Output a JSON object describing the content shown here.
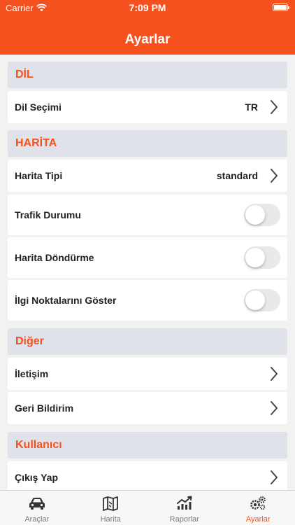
{
  "status": {
    "carrier": "Carrier",
    "time": "7:09 PM"
  },
  "header": {
    "title": "Ayarlar"
  },
  "sections": {
    "dil": {
      "title": "DİL",
      "dil_secimi": {
        "label": "Dil Seçimi",
        "value": "TR"
      }
    },
    "harita": {
      "title": "HARİTA",
      "harita_tipi": {
        "label": "Harita Tipi",
        "value": "standard"
      },
      "trafik": {
        "label": "Trafik Durumu",
        "on": false
      },
      "dondurme": {
        "label": "Harita Döndürme",
        "on": false
      },
      "ilgi": {
        "label": "İlgi Noktalarını Göster",
        "on": false
      }
    },
    "diger": {
      "title": "Diğer",
      "iletisim": {
        "label": "İletişim"
      },
      "geri_bildirim": {
        "label": "Geri Bildirim"
      }
    },
    "kullanici": {
      "title": "Kullanıcı",
      "cikis": {
        "label": "Çıkış Yap"
      }
    }
  },
  "tabbar": {
    "tabs": [
      {
        "label": "Araçlar",
        "icon": "car-icon"
      },
      {
        "label": "Harita",
        "icon": "map-icon"
      },
      {
        "label": "Raporlar",
        "icon": "chart-icon"
      },
      {
        "label": "Ayarlar",
        "icon": "gears-icon"
      }
    ],
    "active_index": 3
  },
  "colors": {
    "accent": "#f4511e",
    "section_bg": "#dfe2e8",
    "tab_inactive": "#7a7a7a"
  }
}
